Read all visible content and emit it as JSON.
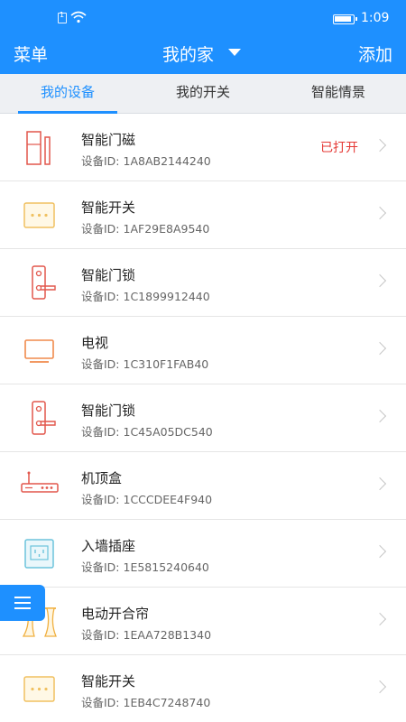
{
  "status_bar": {
    "time": "1:09"
  },
  "app_bar": {
    "menu_label": "菜单",
    "home_title": "我的家",
    "add_label": "添加"
  },
  "tabs": [
    {
      "label": "我的设备",
      "active": true
    },
    {
      "label": "我的开关",
      "active": false
    },
    {
      "label": "智能情景",
      "active": false
    }
  ],
  "devices": [
    {
      "name": "智能门磁",
      "id": "设备ID: 1A8AB2144240",
      "status": "已打开",
      "icon": "door-sensor-icon"
    },
    {
      "name": "智能开关",
      "id": "设备ID: 1AF29E8A9540",
      "status": "",
      "icon": "smart-switch-icon"
    },
    {
      "name": "智能门锁",
      "id": "设备ID: 1C1899912440",
      "status": "",
      "icon": "door-lock-icon"
    },
    {
      "name": "电视",
      "id": "设备ID: 1C310F1FAB40",
      "status": "",
      "icon": "tv-icon"
    },
    {
      "name": "智能门锁",
      "id": "设备ID: 1C45A05DC540",
      "status": "",
      "icon": "door-lock-icon"
    },
    {
      "name": "机顶盒",
      "id": "设备ID: 1CCCDEE4F940",
      "status": "",
      "icon": "set-top-box-icon"
    },
    {
      "name": "入墙插座",
      "id": "设备ID: 1E5815240640",
      "status": "",
      "icon": "wall-socket-icon"
    },
    {
      "name": "电动开合帘",
      "id": "设备ID: 1EAA728B1340",
      "status": "",
      "icon": "curtain-icon"
    },
    {
      "name": "智能开关",
      "id": "设备ID: 1EB4C7248740",
      "status": "",
      "icon": "smart-switch-icon"
    }
  ],
  "colors": {
    "primary": "#1e90ff",
    "status_open": "#e53935",
    "tab_bg": "#eef0f3"
  }
}
